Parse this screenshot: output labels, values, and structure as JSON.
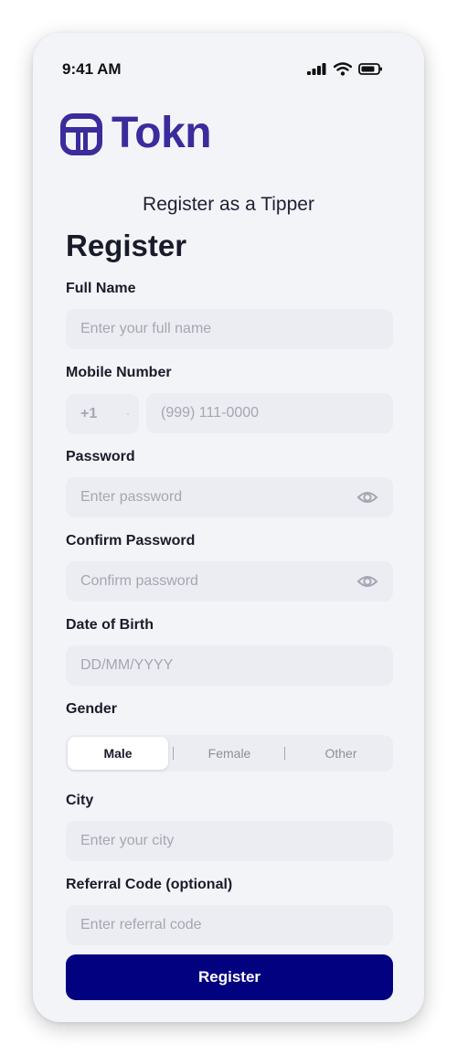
{
  "status_bar": {
    "time": "9:41 AM"
  },
  "brand": {
    "name": "Tokn",
    "color": "#3a2c9c"
  },
  "page": {
    "subtitle": "Register as a Tipper",
    "heading": "Register"
  },
  "form": {
    "full_name": {
      "label": "Full Name",
      "placeholder": "Enter your full name"
    },
    "mobile": {
      "label": "Mobile Number",
      "country_code": "+1",
      "placeholder": "(999) 111-0000"
    },
    "password": {
      "label": "Password",
      "placeholder": "Enter password"
    },
    "confirm_password": {
      "label": "Confirm Password",
      "placeholder": "Confirm password"
    },
    "dob": {
      "label": "Date of Birth",
      "placeholder": "DD/MM/YYYY"
    },
    "gender": {
      "label": "Gender",
      "options": [
        "Male",
        "Female",
        "Other"
      ],
      "selected": "Male"
    },
    "city": {
      "label": "City",
      "placeholder": "Enter your city"
    },
    "referral": {
      "label": "Referral Code (optional)",
      "placeholder": "Enter referral code"
    },
    "submit_label": "Register"
  },
  "colors": {
    "primary": "#020280",
    "background": "#f3f4f8",
    "field": "#ecedf2"
  },
  "icons": [
    "signal-icon",
    "wifi-icon",
    "battery-icon",
    "tokn-logo-icon",
    "eye-icon",
    "chevron-down-icon"
  ]
}
